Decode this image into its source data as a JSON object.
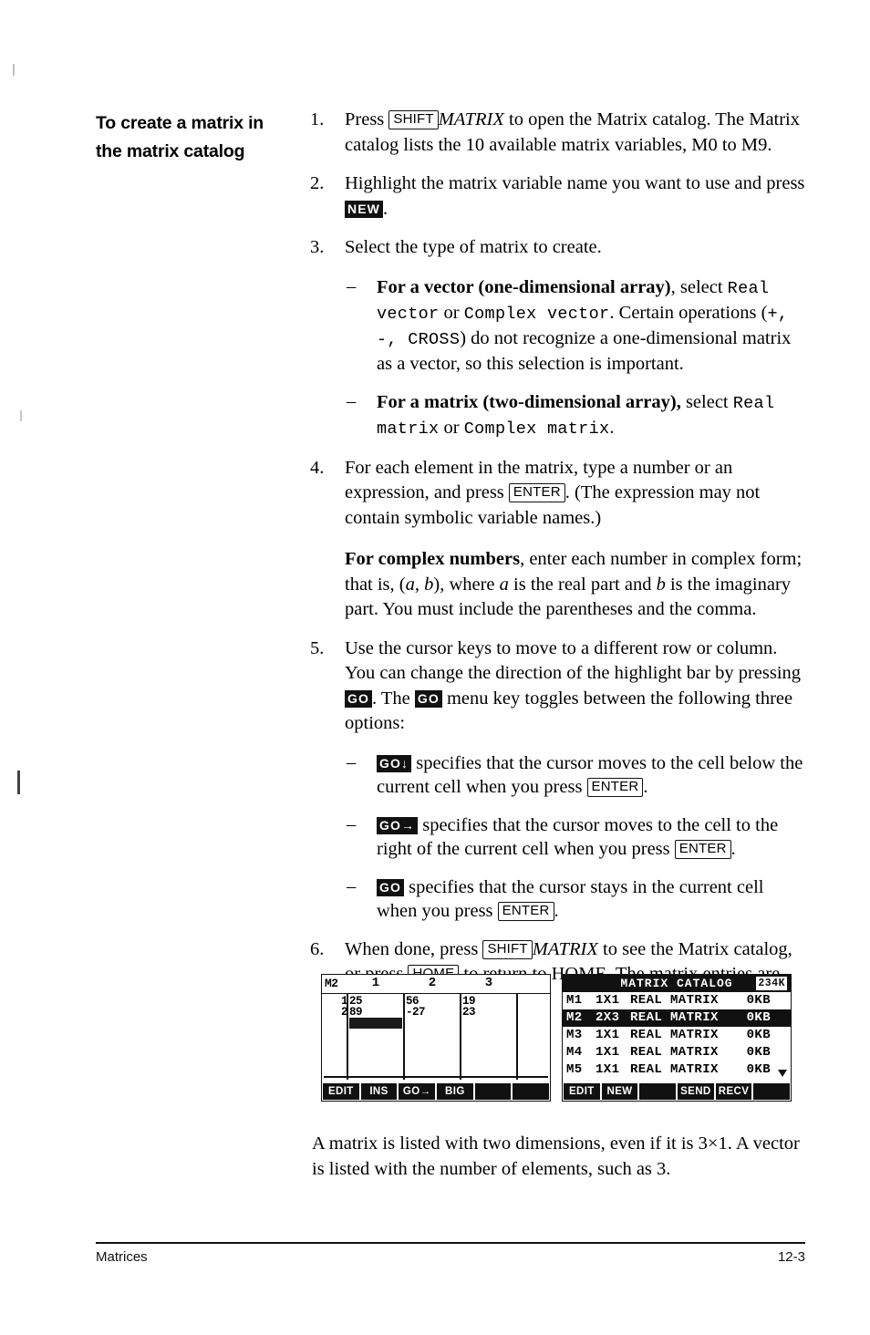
{
  "section_heading": "To create a matrix in the matrix catalog",
  "steps": [
    {
      "num": "1.",
      "parts": [
        {
          "t": "text",
          "v": "Press "
        },
        {
          "t": "key",
          "v": "SHIFT"
        },
        {
          "t": "italic",
          "v": "MATRIX"
        },
        {
          "t": "text",
          "v": " to open the Matrix catalog. The Matrix catalog lists the 10 available matrix variables, M0 to M9."
        }
      ]
    },
    {
      "num": "2.",
      "parts": [
        {
          "t": "text",
          "v": "Highlight the matrix variable name you want to use and press "
        },
        {
          "t": "mkey",
          "v": "NEW"
        },
        {
          "t": "text",
          "v": "."
        }
      ]
    },
    {
      "num": "3.",
      "parts": [
        {
          "t": "text",
          "v": "Select the type of matrix to create."
        }
      ],
      "bullets": [
        {
          "parts": [
            {
              "t": "bold",
              "v": "For a vector (one-dimensional array)"
            },
            {
              "t": "text",
              "v": ", select "
            },
            {
              "t": "mono",
              "v": "Real vector"
            },
            {
              "t": "text",
              "v": " or "
            },
            {
              "t": "mono",
              "v": "Complex vector"
            },
            {
              "t": "text",
              "v": ". Certain operations ("
            },
            {
              "t": "mono",
              "v": "+, -, CROSS"
            },
            {
              "t": "text",
              "v": ") do not recognize a one-dimensional matrix as a vector, so this selection is important."
            }
          ]
        },
        {
          "parts": [
            {
              "t": "bold",
              "v": "For a matrix (two-dimensional array),"
            },
            {
              "t": "text",
              "v": " select "
            },
            {
              "t": "mono",
              "v": "Real matrix"
            },
            {
              "t": "text",
              "v": " or "
            },
            {
              "t": "mono",
              "v": "Complex matrix"
            },
            {
              "t": "text",
              "v": "."
            }
          ]
        }
      ]
    },
    {
      "num": "4.",
      "parts": [
        {
          "t": "text",
          "v": "For each element in the matrix, type a number or an expression, and press "
        },
        {
          "t": "key",
          "v": "ENTER"
        },
        {
          "t": "text",
          "v": ". (The expression may not contain symbolic variable names.)"
        }
      ],
      "para2": [
        {
          "t": "bold",
          "v": "For complex numbers"
        },
        {
          "t": "text",
          "v": ", enter each number in complex form; that is, ("
        },
        {
          "t": "italic",
          "v": "a"
        },
        {
          "t": "text",
          "v": ", "
        },
        {
          "t": "italic",
          "v": "b"
        },
        {
          "t": "text",
          "v": "), where "
        },
        {
          "t": "italic",
          "v": "a"
        },
        {
          "t": "text",
          "v": " is the real part and "
        },
        {
          "t": "italic",
          "v": "b"
        },
        {
          "t": "text",
          "v": " is the imaginary part. You must include the parentheses and the comma."
        }
      ]
    },
    {
      "num": "5.",
      "parts": [
        {
          "t": "text",
          "v": "Use the cursor keys to move to a different row or column. You can change the direction of the highlight bar by pressing "
        },
        {
          "t": "mkey",
          "v": "GO"
        },
        {
          "t": "text",
          "v": ". The "
        },
        {
          "t": "mkey",
          "v": "GO"
        },
        {
          "t": "text",
          "v": " menu key toggles between the following three options:"
        }
      ],
      "bullets": [
        {
          "parts": [
            {
              "t": "mkey",
              "v": "GO↓"
            },
            {
              "t": "text",
              "v": " specifies that the cursor moves to the cell below the current cell when you press "
            },
            {
              "t": "key",
              "v": "ENTER"
            },
            {
              "t": "text",
              "v": "."
            }
          ]
        },
        {
          "parts": [
            {
              "t": "mkey",
              "v": "GO→"
            },
            {
              "t": "text",
              "v": " specifies that the cursor moves to the cell to the right of the current cell when you press "
            },
            {
              "t": "key",
              "v": "ENTER"
            },
            {
              "t": "text",
              "v": "."
            }
          ]
        },
        {
          "parts": [
            {
              "t": "mkey",
              "v": "GO"
            },
            {
              "t": "text",
              "v": " specifies that the cursor stays in the current cell when you press "
            },
            {
              "t": "key",
              "v": "ENTER"
            },
            {
              "t": "text",
              "v": "."
            }
          ]
        }
      ]
    },
    {
      "num": "6.",
      "parts": [
        {
          "t": "text",
          "v": "When done, press "
        },
        {
          "t": "key",
          "v": "SHIFT"
        },
        {
          "t": "italic",
          "v": "MATRIX"
        },
        {
          "t": "text",
          "v": " to see the Matrix catalog, or press "
        },
        {
          "t": "key",
          "v": "HOME"
        },
        {
          "t": "text",
          "v": " to return to HOME. The matrix entries are automatically stored."
        }
      ]
    }
  ],
  "figure_matrix_editor": {
    "variable_label": "M2",
    "column_headers": [
      "1",
      "2",
      "3"
    ],
    "row_numbers": [
      "1",
      "2"
    ],
    "cells": [
      [
        "25",
        "56",
        "19"
      ],
      [
        "89",
        "-27",
        "23"
      ]
    ],
    "soft_keys": [
      "EDIT",
      "INS",
      "GO→",
      "BIG",
      "",
      ""
    ]
  },
  "figure_matrix_catalog": {
    "title": "MATRIX CATALOG",
    "free_memory": "234K",
    "rows": [
      {
        "name": "M1",
        "dim": "1X1",
        "type": "REAL MATRIX",
        "size": "0KB",
        "selected": false
      },
      {
        "name": "M2",
        "dim": "2X3",
        "type": "REAL MATRIX",
        "size": "0KB",
        "selected": true
      },
      {
        "name": "M3",
        "dim": "1X1",
        "type": "REAL MATRIX",
        "size": "0KB",
        "selected": false
      },
      {
        "name": "M4",
        "dim": "1X1",
        "type": "REAL MATRIX",
        "size": "0KB",
        "selected": false
      },
      {
        "name": "M5",
        "dim": "1X1",
        "type": "REAL MATRIX",
        "size": "0KB",
        "selected": false
      }
    ],
    "soft_keys": [
      "EDIT",
      "NEW",
      "",
      "SEND",
      "RECV",
      ""
    ]
  },
  "closing_paragraph": "A matrix is listed with two dimensions, even if it is 3×1. A vector is listed with the number of elements, such as 3.",
  "footer": {
    "left": "Matrices",
    "right": "12-3"
  }
}
